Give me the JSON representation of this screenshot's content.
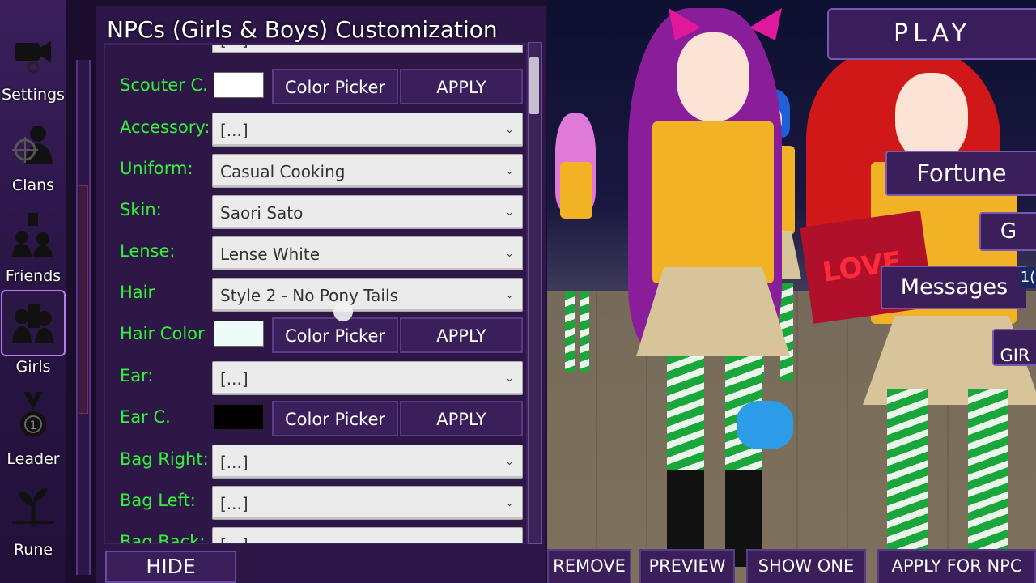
{
  "nav": {
    "items": [
      {
        "label": "Settings",
        "icon": "camera-gear-icon"
      },
      {
        "label": "Clans",
        "icon": "crosshair-person-icon"
      },
      {
        "label": "Friends",
        "icon": "friends-lock-icon"
      },
      {
        "label": "Girls",
        "icon": "girls-group-icon",
        "active": true
      },
      {
        "label": "Leader",
        "icon": "medal-icon"
      },
      {
        "label": "Rune",
        "icon": "rune-plant-icon"
      }
    ]
  },
  "panel": {
    "title": "NPCs (Girls & Boys) Customization",
    "partial_value": "[...]",
    "color_picker_label": "Color Picker",
    "apply_label": "APPLY",
    "rows": {
      "scouter": {
        "label": "Scouter C.",
        "color": "#ffffff"
      },
      "accessory": {
        "label": "Accessory:",
        "value": "[...]"
      },
      "uniform": {
        "label": "Uniform:",
        "value": "Casual Cooking"
      },
      "skin": {
        "label": "Skin:",
        "value": "Saori Sato"
      },
      "lense": {
        "label": "Lense:",
        "value": "Lense White"
      },
      "hair": {
        "label": "Hair",
        "value": "Style 2 - No Pony Tails"
      },
      "hair_color": {
        "label": "Hair Color",
        "color": "#eefbf6"
      },
      "ear": {
        "label": "Ear:",
        "value": "[...]"
      },
      "ear_color": {
        "label": "Ear C.",
        "color": "#000000"
      },
      "bag_right": {
        "label": "Bag Right:",
        "value": "[...]"
      },
      "bag_left": {
        "label": "Bag Left:",
        "value": "[...]"
      },
      "bag_back": {
        "label": "Bag Back:",
        "value": "[...]"
      }
    },
    "hide_label": "HIDE"
  },
  "scene": {
    "banner_text": "LOVE"
  },
  "right_menu": {
    "play": "PLAY",
    "fortune": "Fortune",
    "g": "G",
    "messages": "Messages",
    "messages_badge": "1(",
    "girls": "GIR"
  },
  "bottom_bar": {
    "remove": "REMOVE",
    "preview": "PREVIEW",
    "show_one": "SHOW ONE",
    "apply_for_npc": "APPLY FOR NPC"
  },
  "colors": {
    "label_green": "#3ee84b",
    "panel_bg": "#2d1748",
    "button_bg": "#3b1f5a"
  }
}
